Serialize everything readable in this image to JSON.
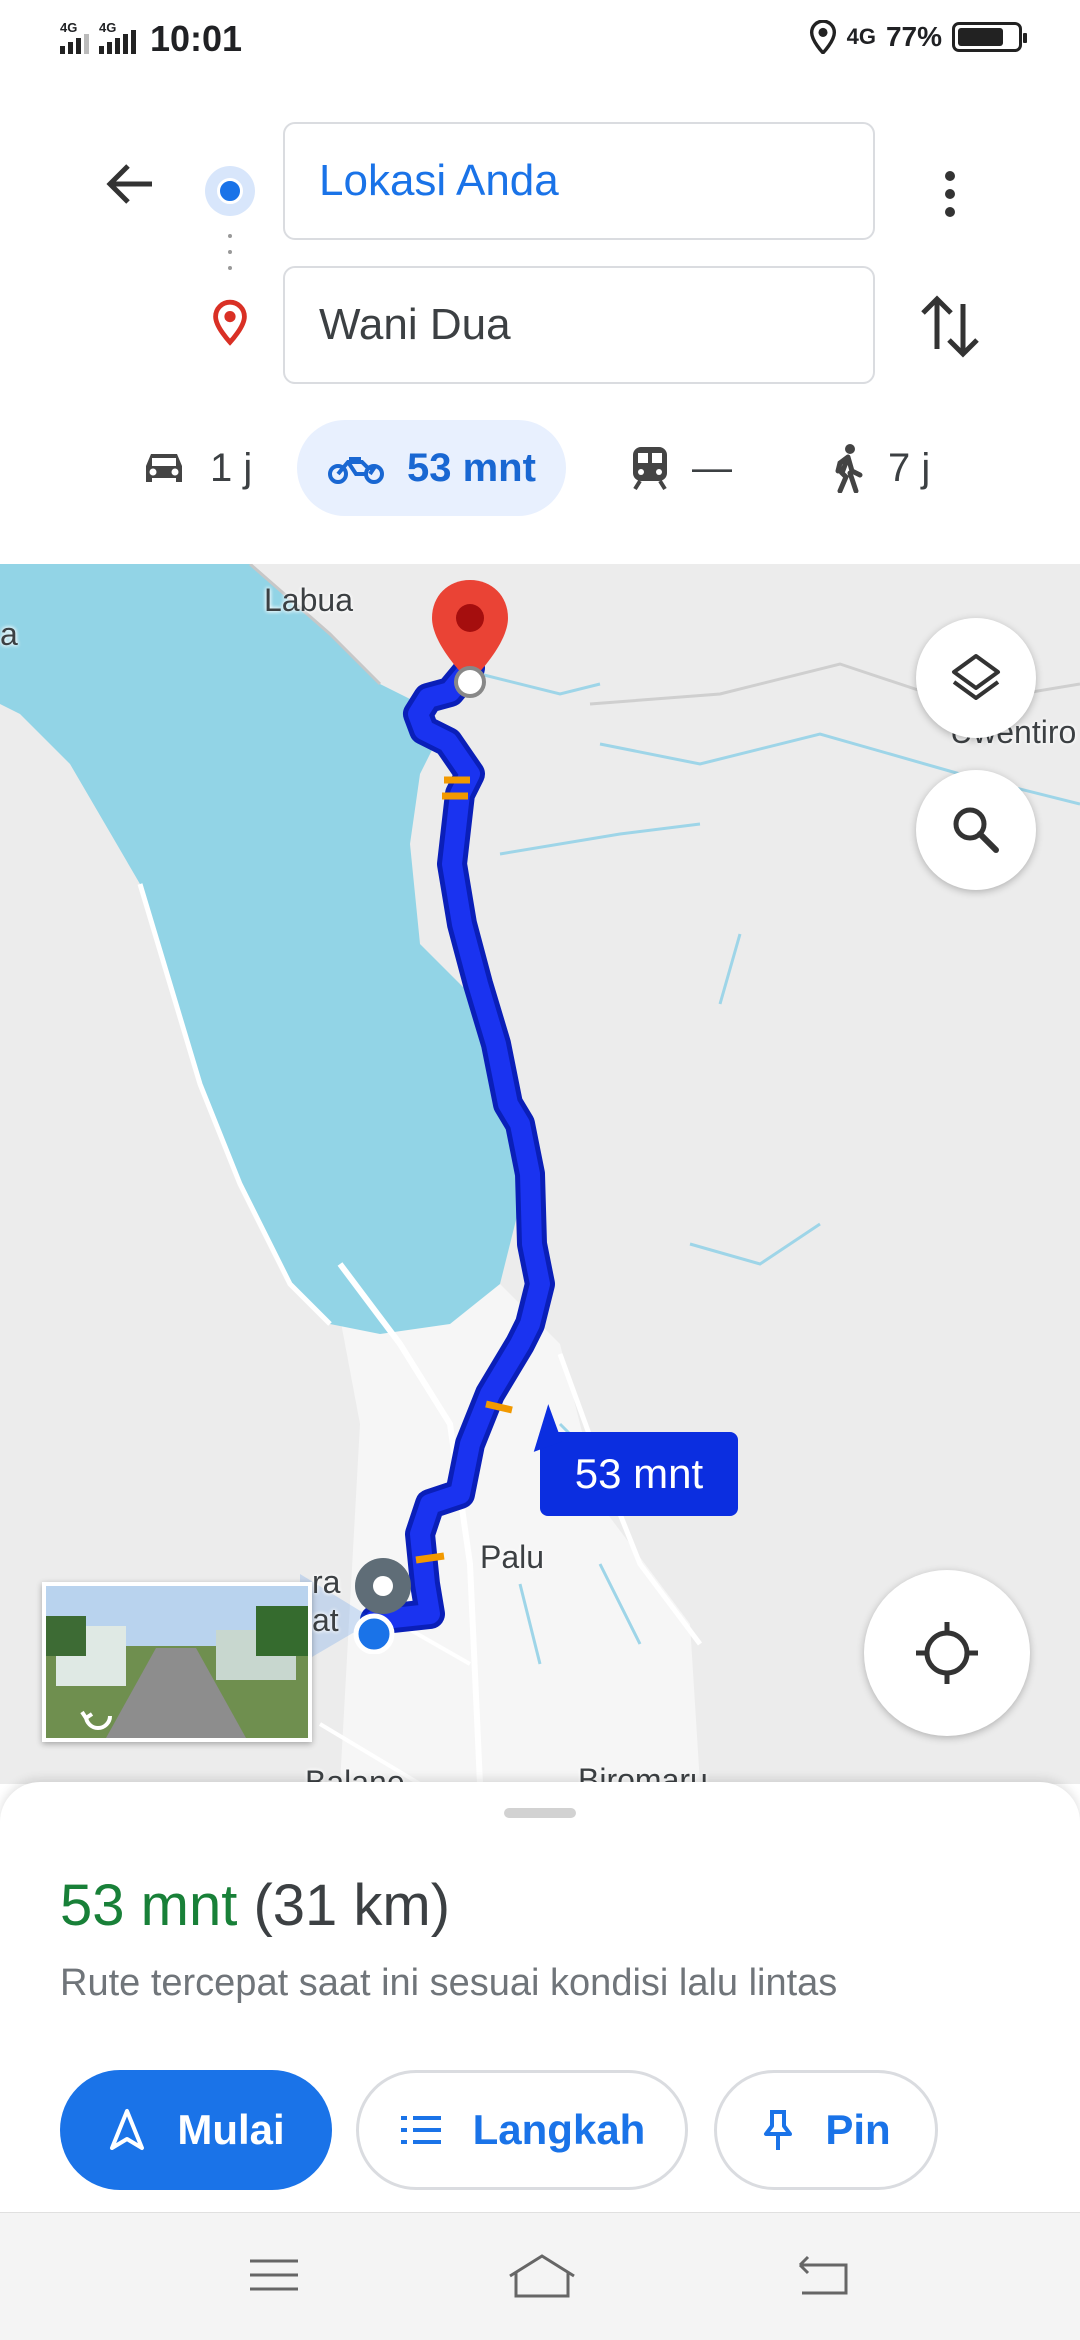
{
  "status_bar": {
    "network_1": "4G",
    "network_2": "4G",
    "time": "10:01",
    "network_right": "4G",
    "battery": "77%",
    "battery_level": 0.77
  },
  "search": {
    "origin": "Lokasi Anda",
    "destination": "Wani Dua"
  },
  "modes": [
    {
      "icon": "car-icon",
      "label": "1 j"
    },
    {
      "icon": "motorcycle-icon",
      "label": "53 mnt",
      "active": true
    },
    {
      "icon": "train-icon",
      "label": "—"
    },
    {
      "icon": "walk-icon",
      "label": "7 j"
    }
  ],
  "map": {
    "labels": {
      "labua": "Labua",
      "uwentiro": "Uwentiro",
      "palu": "Palu",
      "ra": "ra",
      "at": "at",
      "balane": "Balane",
      "biromaru": "Biromaru",
      "a": "a"
    },
    "route_chip": "53 mnt",
    "route_color": "#1a33f0",
    "water_color": "#92d4e6"
  },
  "sheet": {
    "time": "53 mnt",
    "distance": "(31 km)",
    "description": "Rute tercepat saat ini sesuai kondisi lalu lintas",
    "start_label": "Mulai",
    "steps_label": "Langkah",
    "pin_label": "Pin"
  },
  "colors": {
    "accent": "#1a73e8",
    "time_green": "#188038"
  }
}
